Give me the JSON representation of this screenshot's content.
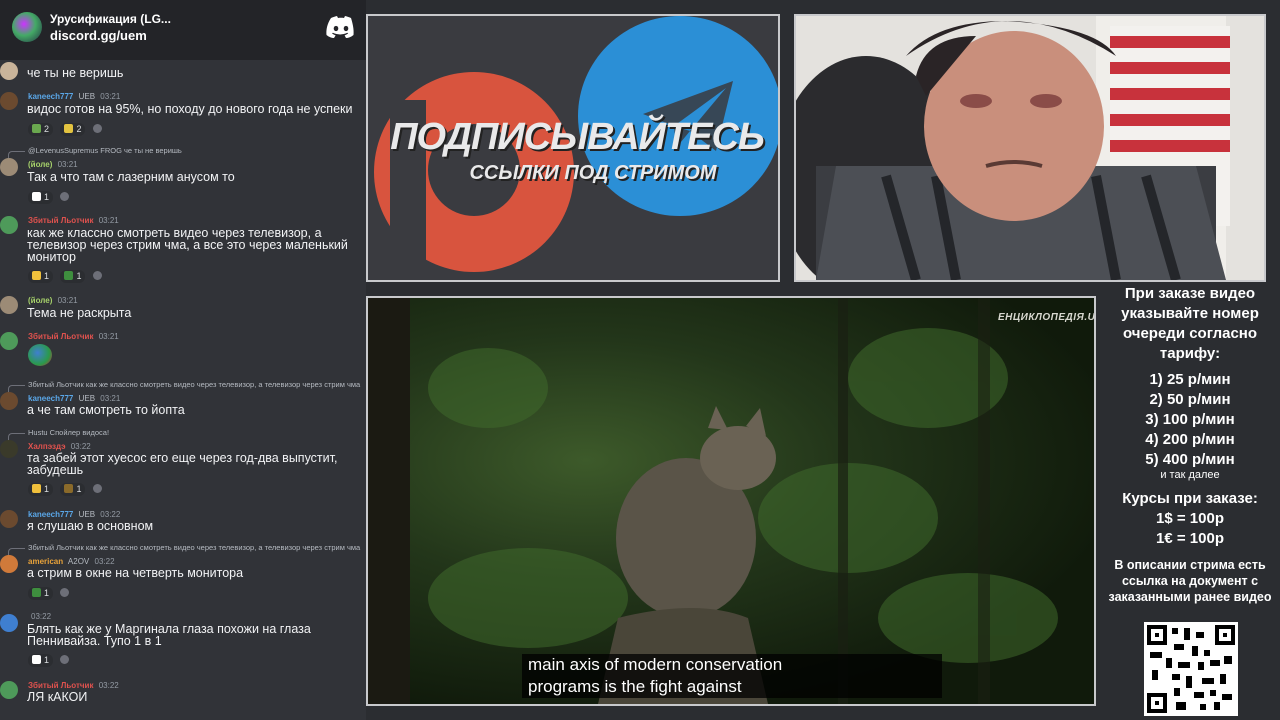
{
  "discord": {
    "server_name": "Урусификация (LG...",
    "invite": "discord.gg/uem",
    "messages": [
      {
        "id": "m0",
        "text": "че ты не веришь"
      },
      {
        "id": "m1",
        "author": "kaneech777",
        "tags": "UEB",
        "time": "03:21",
        "text": "видос готов на 95%, но походу до нового года не успеки",
        "reactions": [
          "2",
          "2"
        ]
      },
      {
        "id": "m2",
        "reply": "@LevenusSupremus FROG че ты не веришь",
        "author": "(йоле)",
        "time": "03:21",
        "text": "Так а что там с лазерним анусом то",
        "reactions": [
          "1"
        ]
      },
      {
        "id": "m3",
        "author": "Збитый Льотчик",
        "time": "03:21",
        "text": "как же классно смотреть видео через телевизор, а телевизор через стрим чма, а все это через маленький монитор",
        "reactions": [
          "1",
          "1"
        ]
      },
      {
        "id": "m4",
        "author": "(йоле)",
        "time": "03:21",
        "text": "Тема не раскрыта"
      },
      {
        "id": "m5",
        "author": "Збитый Льотчик",
        "time": "03:21",
        "text": ""
      },
      {
        "id": "m6",
        "reply": "Збитый Льотчик как же классно смотреть видео через телевизор, а телевизор через стрим чма",
        "author": "kaneech777",
        "tags": "UEB",
        "time": "03:21",
        "text": "а че там смотреть то йопта"
      },
      {
        "id": "m7",
        "reply": "Hustu Спойлер видоса!",
        "author": "Халпэздэ",
        "time": "03:22",
        "text": "та забей этот хуесос его еще через год-два выпустит, забудешь",
        "reactions": [
          "1",
          "1"
        ]
      },
      {
        "id": "m8",
        "author": "kaneech777",
        "tags": "UEB",
        "time": "03:22",
        "text": "я слушаю в основном"
      },
      {
        "id": "m9",
        "reply": "Збитый Льотчик как же классно смотреть видео через телевизор, а телевизор через стрим чма",
        "author": "american",
        "tags": "A2OV",
        "time": "03:22",
        "text": "а стрим в окне на четверть монитора",
        "reactions": [
          "1"
        ]
      },
      {
        "id": "m10",
        "author": "",
        "time": "03:22",
        "text": "Блять как же у Маргинала глаза похожи на глаза Пеннивайза. Тупо 1 в 1",
        "reactions": [
          "1"
        ]
      },
      {
        "id": "m11",
        "author": "Збитый Льотчик",
        "time": "03:22",
        "text": "ЛЯ кАКОИ"
      }
    ]
  },
  "promo": {
    "headline": "ПОДПИСЫВАЙТЕСЬ",
    "subline": "ССЫЛКИ ПОД СТРИМОМ"
  },
  "video": {
    "watermark": "ЕНЦИКЛОПЕДІЯ.UA",
    "subtitle_line1": "main axis of modern conservation",
    "subtitle_line2": "programs is the fight against"
  },
  "info": {
    "order_title": "При заказе видео указывайте номер очереди согласно тарифу:",
    "prices": [
      "1) 25 р/мин",
      "2) 50 р/мин",
      "3) 100 р/мин",
      "4) 200 р/мин",
      "5) 400 р/мин"
    ],
    "and_more": "и так далее",
    "rates_title": "Курсы при заказе:",
    "rates": [
      "1$ = 100р",
      "1€ = 100р"
    ],
    "description": "В описании стрима есть ссылка на документ с заказанными ранее видео"
  },
  "colors": {
    "chat_bg": "#313338",
    "header_bg": "#232428",
    "patreon": "#d8543e",
    "telegram": "#2b8fd6",
    "panel_border": "#c8c9cc"
  }
}
